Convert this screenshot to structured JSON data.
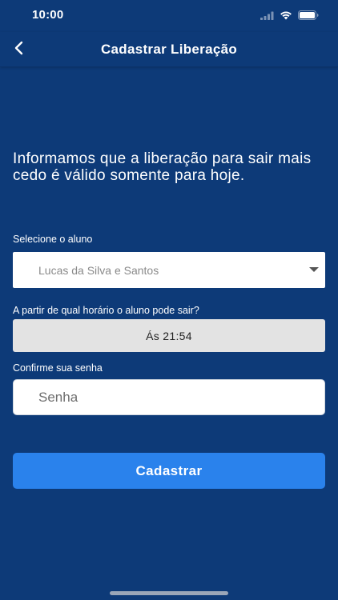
{
  "status_bar": {
    "time": "10:00",
    "icons": [
      "cellular-icon",
      "wifi-icon",
      "battery-icon"
    ]
  },
  "nav": {
    "back_icon": "chevron-left-icon",
    "title": "Cadastrar Liberação"
  },
  "info": {
    "text": "Informamos que a liberação para sair mais cedo é válido somente para hoje."
  },
  "student_field": {
    "label": "Selecione o aluno",
    "selected_value": "Lucas da Silva e Santos",
    "arrow_icon": "caret-down-icon"
  },
  "time_field": {
    "label": "A partir de qual horário o aluno pode sair?",
    "value": "Ás 21:54"
  },
  "password_field": {
    "label": "Confirme sua senha",
    "placeholder": "Senha"
  },
  "submit": {
    "label": "Cadastrar"
  },
  "colors": {
    "background": "#0d3a78",
    "primary_button": "#2a82ec",
    "time_button": "#e3e3e3"
  }
}
